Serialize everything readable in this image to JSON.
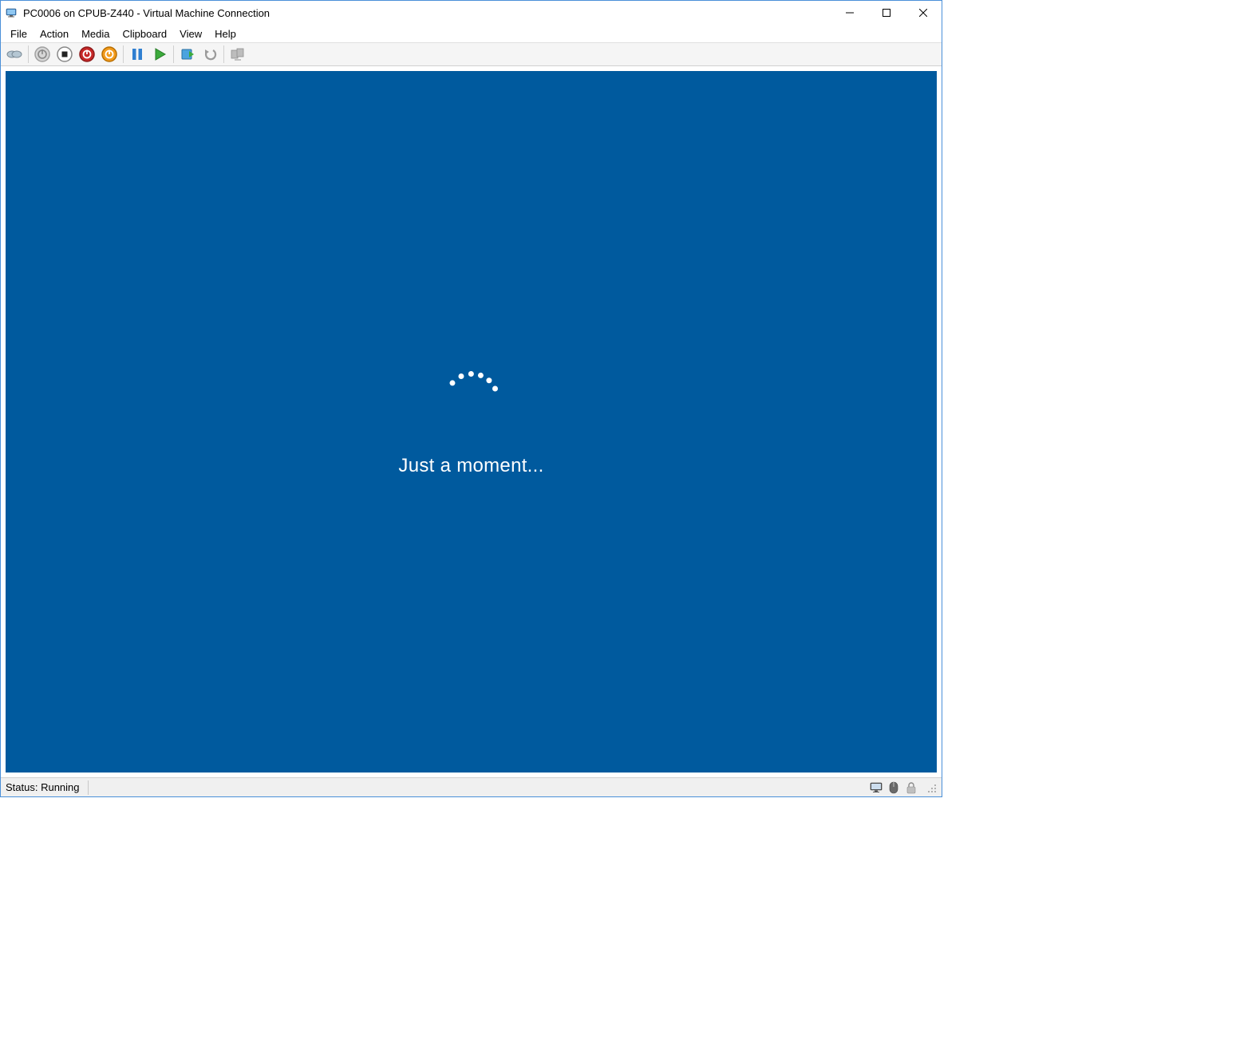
{
  "window": {
    "title": "PC0006 on CPUB-Z440 - Virtual Machine Connection"
  },
  "menu": {
    "items": [
      "File",
      "Action",
      "Media",
      "Clipboard",
      "View",
      "Help"
    ]
  },
  "toolbar": {
    "icons": [
      "ctrl-alt-del",
      "turn-off",
      "shutdown",
      "stop",
      "reset",
      "pause",
      "start",
      "checkpoint",
      "revert",
      "share"
    ]
  },
  "guest": {
    "message": "Just a moment...",
    "background_color": "#005a9e"
  },
  "status": {
    "text": "Status: Running",
    "icons": [
      "monitor",
      "mouse",
      "lock"
    ]
  }
}
